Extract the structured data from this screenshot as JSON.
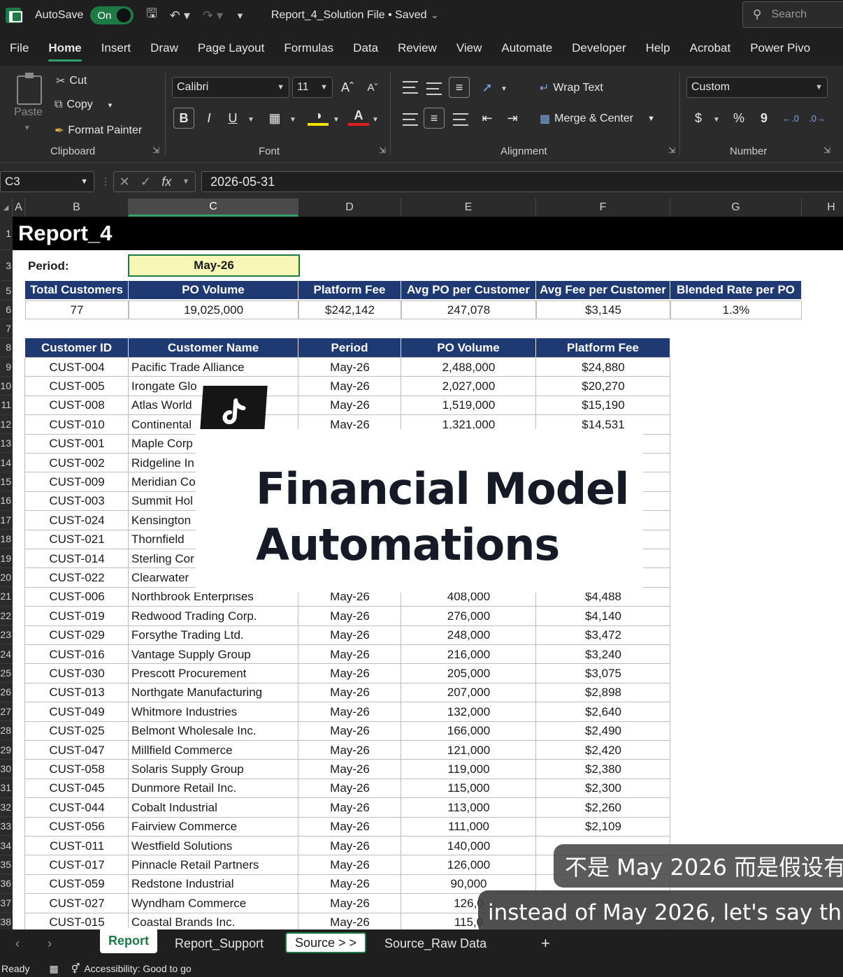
{
  "titlebar": {
    "autosave_label": "AutoSave",
    "autosave_state": "On",
    "file_name": "Report_4_Solution File • Saved",
    "search_placeholder": "Search"
  },
  "menu": [
    "File",
    "Home",
    "Insert",
    "Draw",
    "Page Layout",
    "Formulas",
    "Data",
    "Review",
    "View",
    "Automate",
    "Developer",
    "Help",
    "Acrobat",
    "Power Pivo"
  ],
  "ribbon": {
    "clipboard": {
      "paste": "Paste",
      "cut": "Cut",
      "copy": "Copy",
      "format_painter": "Format Painter",
      "label": "Clipboard"
    },
    "font": {
      "name": "Calibri",
      "size": "11",
      "bold": "B",
      "italic": "I",
      "underline": "U",
      "label": "Font"
    },
    "alignment": {
      "wrap": "Wrap Text",
      "merge": "Merge & Center",
      "label": "Alignment"
    },
    "number": {
      "format": "Custom",
      "currency": "$",
      "percent": "%",
      "comma": "9",
      "label": "Number"
    }
  },
  "formula_bar": {
    "name_box": "C3",
    "fx": "fx",
    "formula": "2026-05-31"
  },
  "columns": [
    "A",
    "B",
    "C",
    "D",
    "E",
    "F",
    "G",
    "H"
  ],
  "row_numbers": [
    "1",
    "3",
    "5",
    "6",
    "7",
    "8",
    "9",
    "10",
    "11",
    "12",
    "13",
    "14",
    "15",
    "16",
    "17",
    "18",
    "19",
    "20",
    "21",
    "22",
    "23",
    "24",
    "25",
    "26",
    "27",
    "28",
    "29",
    "30",
    "31",
    "32",
    "33",
    "34",
    "35",
    "36",
    "37",
    "38"
  ],
  "sheet": {
    "title": "Report_4",
    "period_label": "Period:",
    "period_value": "May-26",
    "summary_headers": [
      "Total Customers",
      "PO Volume",
      "Platform Fee",
      "Avg PO per Customer",
      "Avg Fee per Customer",
      "Blended Rate per PO"
    ],
    "summary_values": [
      "77",
      "19,025,000",
      "$242,142",
      "247,078",
      "$3,145",
      "1.3%"
    ],
    "table_headers": [
      "Customer ID",
      "Customer Name",
      "Period",
      "PO Volume",
      "Platform Fee"
    ],
    "rows": [
      [
        "CUST-004",
        "Pacific Trade Alliance",
        "May-26",
        "2,488,000",
        "$24,880"
      ],
      [
        "CUST-005",
        "Irongate Glo",
        "May-26",
        "2,027,000",
        "$20,270"
      ],
      [
        "CUST-008",
        "Atlas World",
        "May-26",
        "1,519,000",
        "$15,190"
      ],
      [
        "CUST-010",
        "Continental",
        "May-26",
        "1,321,000",
        "$14,531"
      ],
      [
        "CUST-001",
        "Maple Corp",
        "",
        "",
        ""
      ],
      [
        "CUST-002",
        "Ridgeline In",
        "",
        "",
        ""
      ],
      [
        "CUST-009",
        "Meridian Co",
        "",
        "",
        ""
      ],
      [
        "CUST-003",
        "Summit Hol",
        "",
        "",
        ""
      ],
      [
        "CUST-024",
        "Kensington",
        "",
        "",
        ""
      ],
      [
        "CUST-021",
        "Thornfield",
        "",
        "",
        ""
      ],
      [
        "CUST-014",
        "Sterling Cor",
        "",
        "",
        ""
      ],
      [
        "CUST-022",
        "Clearwater",
        "",
        "",
        ""
      ],
      [
        "CUST-006",
        "Northbrook Enterprises",
        "May-26",
        "408,000",
        "$4,488"
      ],
      [
        "CUST-019",
        "Redwood Trading Corp.",
        "May-26",
        "276,000",
        "$4,140"
      ],
      [
        "CUST-029",
        "Forsythe Trading Ltd.",
        "May-26",
        "248,000",
        "$3,472"
      ],
      [
        "CUST-016",
        "Vantage Supply Group",
        "May-26",
        "216,000",
        "$3,240"
      ],
      [
        "CUST-030",
        "Prescott Procurement",
        "May-26",
        "205,000",
        "$3,075"
      ],
      [
        "CUST-013",
        "Northgate Manufacturing",
        "May-26",
        "207,000",
        "$2,898"
      ],
      [
        "CUST-049",
        "Whitmore Industries",
        "May-26",
        "132,000",
        "$2,640"
      ],
      [
        "CUST-025",
        "Belmont Wholesale Inc.",
        "May-26",
        "166,000",
        "$2,490"
      ],
      [
        "CUST-047",
        "Millfield Commerce",
        "May-26",
        "121,000",
        "$2,420"
      ],
      [
        "CUST-058",
        "Solaris Supply Group",
        "May-26",
        "119,000",
        "$2,380"
      ],
      [
        "CUST-045",
        "Dunmore Retail Inc.",
        "May-26",
        "115,000",
        "$2,300"
      ],
      [
        "CUST-044",
        "Cobalt Industrial",
        "May-26",
        "113,000",
        "$2,260"
      ],
      [
        "CUST-056",
        "Fairview Commerce",
        "May-26",
        "111,000",
        "$2,109"
      ],
      [
        "CUST-011",
        "Westfield Solutions",
        "May-26",
        "140,000",
        ""
      ],
      [
        "CUST-017",
        "Pinnacle Retail Partners",
        "May-26",
        "126,000",
        ""
      ],
      [
        "CUST-059",
        "Redstone Industrial",
        "May-26",
        "90,000",
        ""
      ],
      [
        "CUST-027",
        "Wyndham Commerce",
        "May-26",
        "126,0",
        ""
      ],
      [
        "CUST-015",
        "Coastal Brands Inc.",
        "May-26",
        "115,0",
        ""
      ]
    ]
  },
  "overlay": {
    "title_line1": "Financial Model",
    "title_line2": "Automations",
    "subtitle_zh": "不是 May 2026 而是假设有",
    "subtitle_en": "instead of May 2026, let's say that"
  },
  "tabs": [
    "Report",
    "Report_Support",
    "Source > >",
    "Source_Raw Data"
  ],
  "status": {
    "ready": "Ready",
    "accessibility": "Accessibility: Good to go"
  },
  "colors": {
    "accent": "#1e7a45",
    "header_navy": "#1f3a73",
    "period_fill": "#f8f7b8"
  }
}
